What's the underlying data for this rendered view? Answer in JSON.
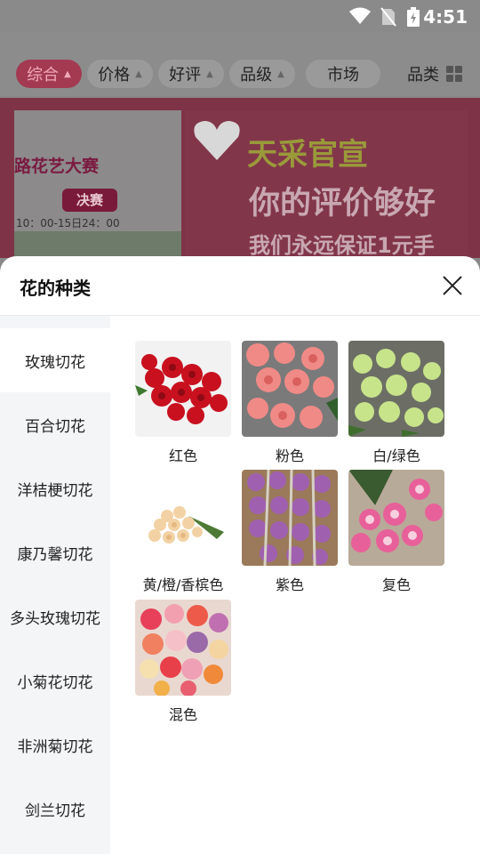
{
  "status_bar": {
    "time": "4:51"
  },
  "filters": {
    "tabs": [
      {
        "label": "综合",
        "active": true
      },
      {
        "label": "价格",
        "active": false
      },
      {
        "label": "好评",
        "active": false
      },
      {
        "label": "品级",
        "active": false
      },
      {
        "label": "市场",
        "active": false
      }
    ],
    "category_label": "品类"
  },
  "banner": {
    "left_title": "路花艺大赛",
    "left_badge": "决赛",
    "left_time": "10：00-15日24：00",
    "right_line1": "天采官宣",
    "right_line2": "你的评价够好",
    "right_line3": "我们永远保证1元手"
  },
  "sheet": {
    "title": "花的种类",
    "sidebar": [
      {
        "label": "玫瑰切花",
        "active": true
      },
      {
        "label": "百合切花",
        "active": false
      },
      {
        "label": "洋桔梗切花",
        "active": false
      },
      {
        "label": "康乃馨切花",
        "active": false
      },
      {
        "label": "多头玫瑰切花",
        "active": false
      },
      {
        "label": "小菊花切花",
        "active": false
      },
      {
        "label": "非洲菊切花",
        "active": false
      },
      {
        "label": "剑兰切花",
        "active": false
      }
    ],
    "colors": [
      {
        "label": "红色",
        "icon": "red-roses-photo"
      },
      {
        "label": "粉色",
        "icon": "pink-roses-photo"
      },
      {
        "label": "白/绿色",
        "icon": "white-green-roses-photo"
      },
      {
        "label": "黄/橙/香槟色",
        "icon": "champagne-roses-photo"
      },
      {
        "label": "紫色",
        "icon": "purple-roses-photo"
      },
      {
        "label": "复色",
        "icon": "bicolor-roses-photo"
      },
      {
        "label": "混色",
        "icon": "mixed-roses-photo"
      }
    ]
  },
  "theme": {
    "accent": "#a33a52",
    "sidebar_bg": "#f4f5f7"
  }
}
